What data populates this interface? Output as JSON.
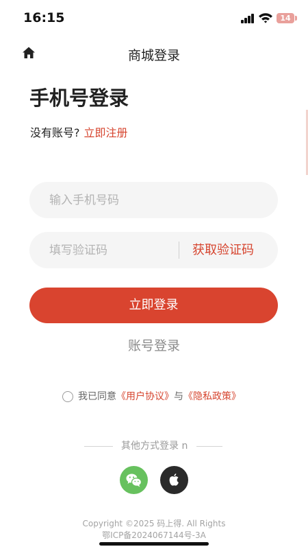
{
  "status_bar": {
    "time": "16:15",
    "battery": "14"
  },
  "nav": {
    "title": "商城登录"
  },
  "login": {
    "heading": "手机号登录",
    "no_account_text": "没有账号?",
    "register_link": "立即注册",
    "phone_placeholder": "输入手机号码",
    "code_placeholder": "填写验证码",
    "get_code_label": "获取验证码",
    "submit_label": "立即登录",
    "account_login_label": "账号登录"
  },
  "agreement": {
    "prefix": "我已同意",
    "user_agreement": "《用户协议》",
    "joiner": "与",
    "privacy_policy": "《隐私政策》"
  },
  "other_login": {
    "label": "其他方式登录",
    "trailing": "n",
    "icons": [
      "wechat-icon",
      "apple-icon"
    ]
  },
  "footer": {
    "copyright": "Copyright ©2025 码上得. All Rights",
    "icp": "鄂ICP备2024067144号-3A"
  },
  "colors": {
    "accent": "#d9442f",
    "wechat": "#67c15e",
    "apple": "#2a2a2a",
    "input_bg": "#f5f5f5"
  }
}
